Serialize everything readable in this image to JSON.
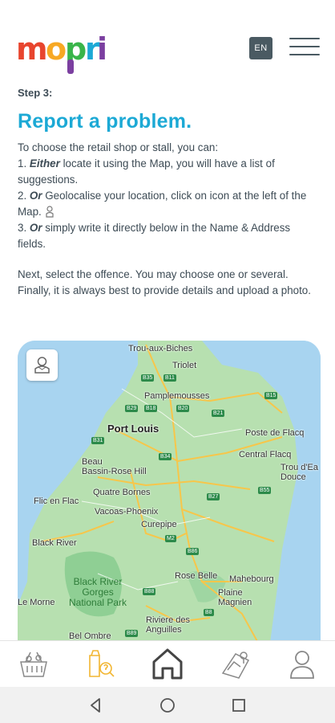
{
  "header": {
    "logo_text": "mopri",
    "language": "EN",
    "logo_colors": [
      "#e8452e",
      "#f7a823",
      "#39b54a",
      "#1ca9d5",
      "#7b3fa0"
    ]
  },
  "content": {
    "step": "Step 3:",
    "title": "Report a problem.",
    "intro": "To choose the retail shop or stall, you can:",
    "option1_prefix": "1. ",
    "option1_em": "Either",
    "option1_rest": " locate it using the Map, you will have a list of suggestions.",
    "option2_prefix": "2. ",
    "option2_em": "Or",
    "option2_rest": " Geolocalise your location, click on icon at the left of the Map.",
    "option3_prefix": "3. ",
    "option3_em": "Or",
    "option3_rest": " simply write it directly below in the Name & Address fields.",
    "next": "Next, select the offence. You may choose one or several. Finally, it is always best to provide details and upload a photo."
  },
  "map": {
    "places": {
      "trou_aux_biches": "Trou-aux-Biches",
      "triolet": "Triolet",
      "pamplemousses": "Pamplemousses",
      "port_louis": "Port Louis",
      "poste_de_flacq": "Poste de Flacq",
      "beau_bassin": "Beau\nBassin-Rose Hill",
      "central_flacq": "Central Flacq",
      "trou_deau_douce": "Trou d'Ea\nDouce",
      "quatre_bornes": "Quatre Bornes",
      "flic_en_flac": "Flic en Flac",
      "vacoas": "Vacoas-Phoenix",
      "curepipe": "Curepipe",
      "black_river": "Black River",
      "rose_belle": "Rose Belle",
      "mahebourg": "Mahebourg",
      "plaine_magnien": "Plaine\nMagnien",
      "park": "Black River\nGorges\nNational Park",
      "le_morne": "Le Morne",
      "riviere_des_anguilles": "Riviere des\nAnguilles",
      "bel_ombre": "Bel Ombre"
    },
    "roads": [
      "B35",
      "B11",
      "B18",
      "B20",
      "B21",
      "B15",
      "B29",
      "B31",
      "B34",
      "B27",
      "B55",
      "M2",
      "B86",
      "B88",
      "B8",
      "B89"
    ],
    "colors": {
      "water": "#a8d4f0",
      "land": "#b7e0b0",
      "forest": "#8fcf94",
      "road": "#f7c64a"
    }
  },
  "tabs": [
    {
      "name": "tab-shops",
      "icon": "basket-icon",
      "active": false
    },
    {
      "name": "tab-report",
      "icon": "report-search-icon",
      "active": true
    },
    {
      "name": "tab-home",
      "icon": "home-icon",
      "active": false
    },
    {
      "name": "tab-map",
      "icon": "map-pin-icon",
      "active": false
    },
    {
      "name": "tab-profile",
      "icon": "user-icon",
      "active": false
    }
  ],
  "system_nav": [
    "back-icon",
    "home-circle-icon",
    "recents-icon"
  ],
  "accent": "#1ca9d5",
  "active_tab_color": "#f2b632"
}
